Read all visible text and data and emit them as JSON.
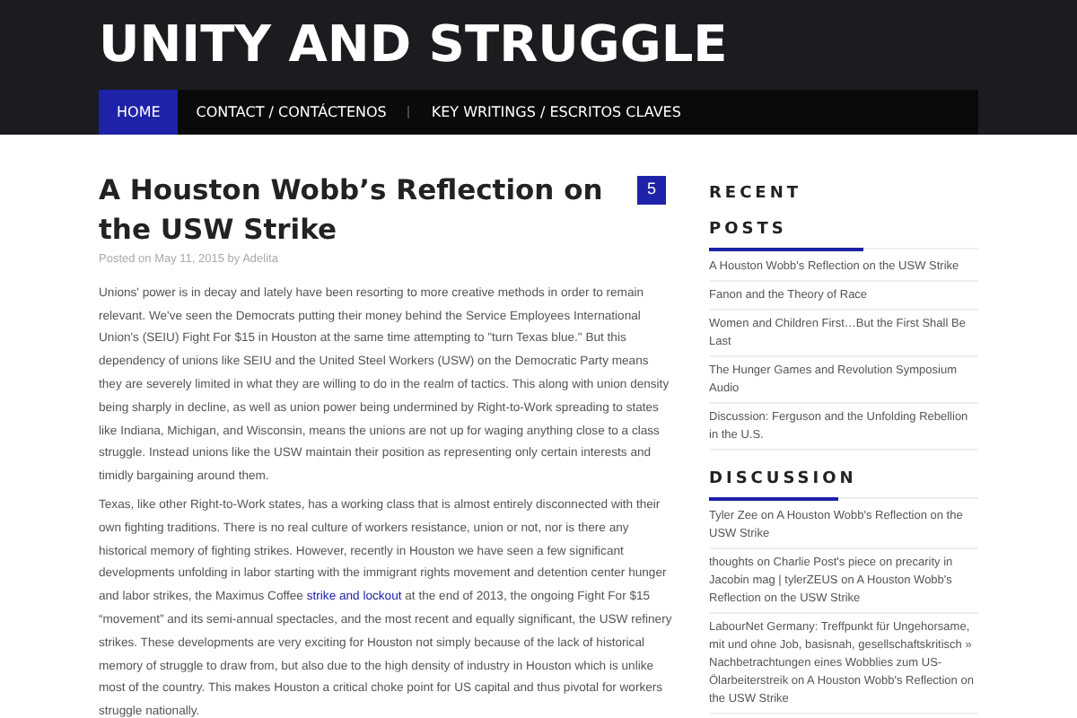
{
  "site_title": "UNITY AND STRUGGLE",
  "nav": [
    {
      "label": "HOME",
      "selected": true
    },
    {
      "label": "CONTACT / CONTÁCTENOS",
      "selected": false
    },
    {
      "label": "KEY WRITINGS / ESCRITOS CLAVES",
      "selected": false
    }
  ],
  "article": {
    "title": "A Houston Wobb’s Reflection on the USW Strike",
    "comment_count": "5",
    "meta": "Posted on May 11, 2015 by Adelita",
    "paragraphs": [
      {
        "text": "Unions' power is in decay and lately have been resorting to more creative methods in order to remain relevant. We've seen the Democrats putting their money behind the Service Employees International Union's (SEIU) Fight For $15 in Houston at the same time attempting to \"turn Texas blue.\" But this dependency of unions like SEIU and the United Steel Workers (USW) on the Democratic Party means they are severely limited in what they are willing to do in the realm of tactics. This along with union density being sharply in decline, as well as union power being undermined by Right-to-Work spreading to states like Indiana, Michigan, and Wisconsin, means the unions are not up for waging anything close to a class struggle. Instead unions like the USW maintain their position as representing only certain interests and timidly bargaining around them."
      },
      {
        "text": "Texas, like other Right-to-Work states, has a working class that is almost entirely disconnected with their own fighting traditions. There is no real culture of workers resistance, union or not, nor is there any historical memory of fighting strikes. However, recently in Houston we have seen a few significant developments unfolding in labor starting with the immigrant rights movement and detention center hunger and labor strikes, the Maximus Coffee",
        "link": "strike and lockout",
        "after": "at the end of 2013, the ongoing Fight For $15 “movement” and its semi-annual spectacles, and the most recent and equally significant, the USW refinery strikes. These developments are very exciting for Houston not simply because of the lack of historical memory of struggle to draw from, but also due to the high density of industry in Houston which is unlike most of the country.  This makes Houston a critical choke point for US capital and thus pivotal for workers struggle nationally."
      }
    ]
  },
  "sidebar": {
    "recent_posts": {
      "heading_lines": [
        "RECENT",
        "POSTS"
      ],
      "items": [
        "A Houston Wobb's Reflection on the USW Strike",
        "Fanon and the Theory of Race",
        "Women and Children First…But the First Shall Be Last",
        "The Hunger Games and Revolution Symposium Audio",
        "Discussion: Ferguson and the Unfolding Rebellion in the U.S."
      ]
    },
    "discussion": {
      "heading": "DISCUSSION",
      "items": [
        "Tyler Zee on A Houston Wobb's Reflection on the USW Strike",
        "thoughts on Charlie Post's piece on precarity in Jacobin mag | tylerZEUS on A Houston Wobb's Reflection on the USW Strike",
        "LabourNet Germany: Treffpunkt für Ungehorsame, mit und ohne Job, basisnah, gesellschaftskritisch » Nachbetrachtungen eines Wobblies zum US-Ölarbeiterstreik on A Houston Wobb's Reflection on the USW Strike"
      ]
    }
  }
}
